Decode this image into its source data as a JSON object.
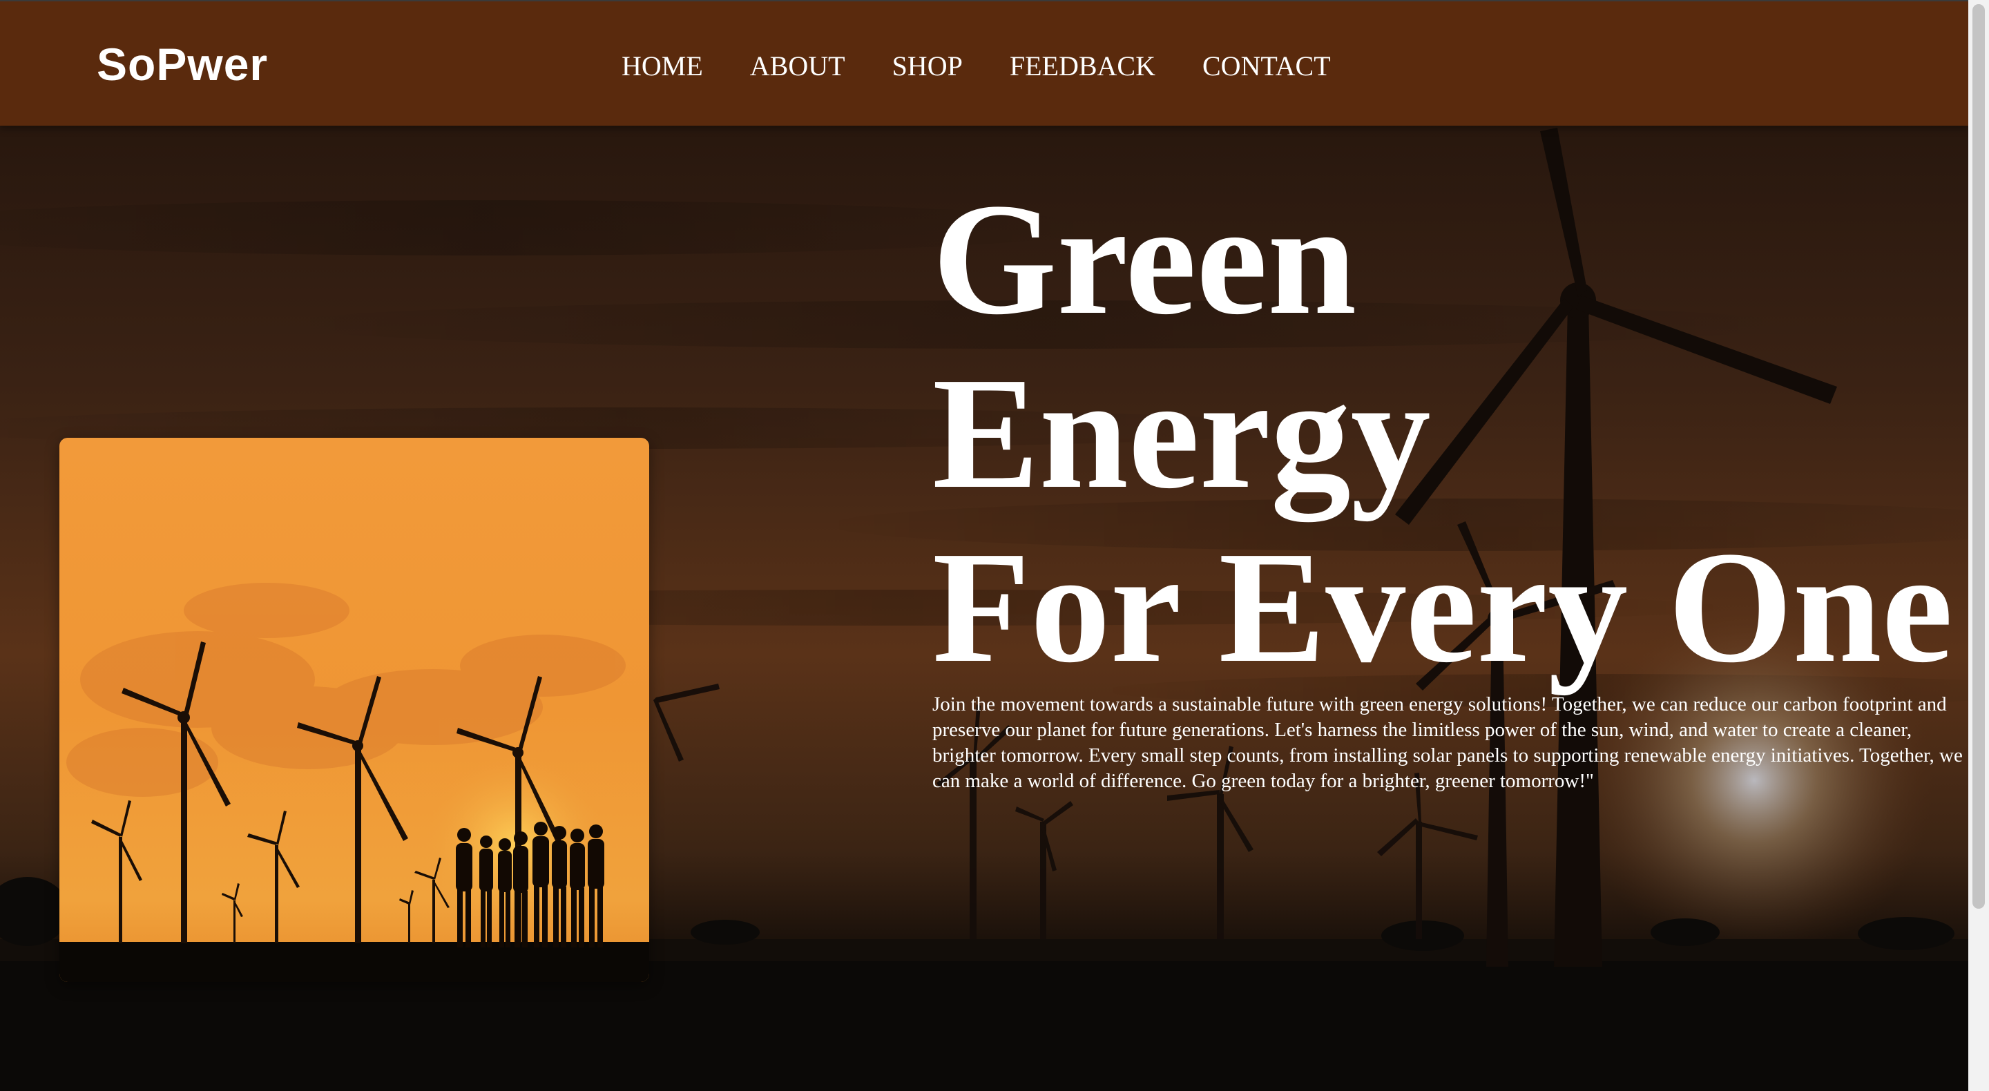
{
  "brand": {
    "name": "SoPwer"
  },
  "nav": {
    "links": [
      {
        "label": "HOME"
      },
      {
        "label": "ABOUT"
      },
      {
        "label": "SHOP"
      },
      {
        "label": "FEEDBACK"
      },
      {
        "label": "CONTACT"
      }
    ]
  },
  "hero": {
    "title_line1": "Green",
    "title_line2": "Energy",
    "title_line3": "For Every One",
    "description": "Join the movement towards a sustainable future with green energy solutions! Together, we can reduce our carbon footprint and preserve our planet for future generations. Let's harness the limitless power of the sun, wind, and water to create a cleaner, brighter tomorrow. Every small step counts, from installing solar panels to supporting renewable energy initiatives. Together, we can make a world of difference. Go green today for a brighter, greener tomorrow!\""
  },
  "colors": {
    "navbar": "#5a2a0d",
    "text": "#ffffff",
    "card_sky": "#f29a3a",
    "background_sky": "#3a1e10"
  },
  "images": {
    "background": "wind-turbines-sunset-image",
    "feature_card": "wind-turbines-people-silhouette-image"
  }
}
